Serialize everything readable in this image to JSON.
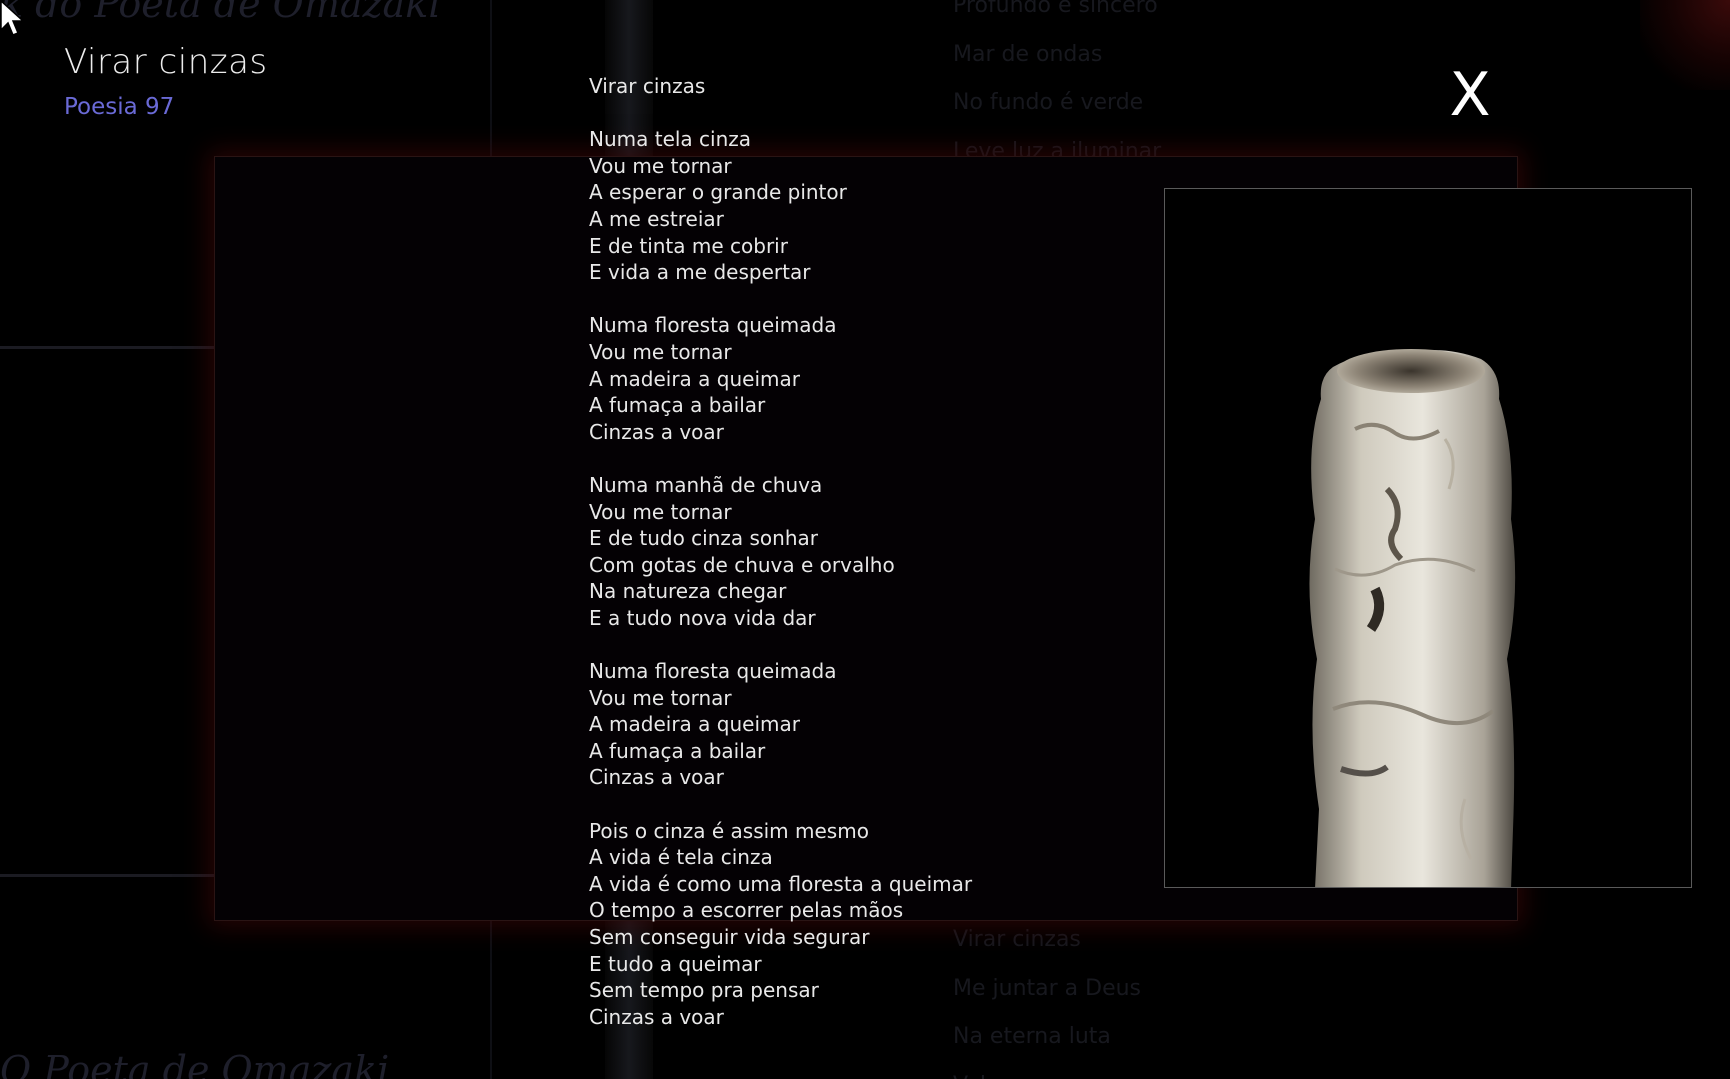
{
  "background": {
    "site_title_fragment": "k do Poeta de Omazaki",
    "site_footer_fragment": "O Poeta de Omazaki",
    "list_top": [
      "Profundo e sincero",
      "Mar de ondas",
      "No fundo é verde",
      "Leve luz a iluminar"
    ],
    "list_bottom": [
      "Virar cinzas",
      "Me juntar a Deus",
      "Na eterna luta",
      "Valeu"
    ]
  },
  "overlay": {
    "title": "Virar cinzas",
    "subtitle": "Poesia 97",
    "close_label": "X",
    "poem_title": "Virar cinzas",
    "stanzas": [
      [
        "Numa tela cinza",
        "Vou me tornar",
        "A esperar o grande pintor",
        "A me estreiar",
        "E de tinta me cobrir",
        "E vida a me despertar"
      ],
      [
        "Numa floresta queimada",
        "Vou me tornar",
        "A madeira a queimar",
        "A fumaça a bailar",
        "Cinzas a voar"
      ],
      [
        "Numa manhã de chuva",
        "Vou me tornar",
        "E de tudo cinza sonhar",
        "Com gotas de chuva e orvalho",
        "Na natureza chegar",
        "E a tudo nova vida dar"
      ],
      [
        "Numa floresta queimada",
        "Vou me tornar",
        "A madeira a queimar",
        "A fumaça a bailar",
        "Cinzas a voar"
      ],
      [
        "Pois o cinza é assim mesmo",
        "A vida é tela cinza",
        "A vida é como uma floresta a queimar",
        "O tempo a escorrer pelas mãos",
        "Sem conseguir vida segurar",
        "E tudo a queimar",
        "Sem tempo pra pensar",
        "Cinzas a voar"
      ]
    ],
    "photo_subject": "cigarette-ash-photo"
  },
  "colors": {
    "background": "#000000",
    "title": "#ececec",
    "subtitle": "#6a6ad6",
    "poem_text": "#e8e8e8",
    "frame_glow": "#460808"
  }
}
